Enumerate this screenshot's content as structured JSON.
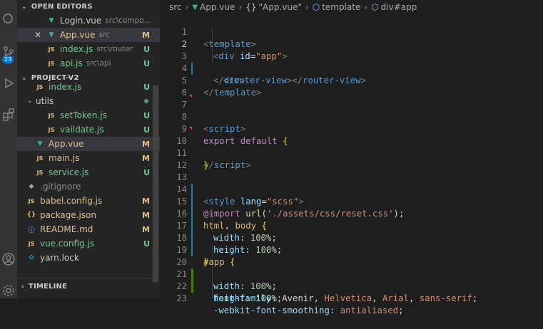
{
  "activity_bar": {
    "badge": "23"
  },
  "open_editors": {
    "title": "OPEN EDITORS",
    "items": [
      {
        "name": "Login.vue",
        "desc": "src\\compo...",
        "status": ""
      },
      {
        "name": "App.vue",
        "desc": "src",
        "status": "M"
      },
      {
        "name": "index.js",
        "desc": "src\\router",
        "status": "U"
      },
      {
        "name": "api.js",
        "desc": "src\\api",
        "status": "U"
      }
    ]
  },
  "project": {
    "title": "PROJECT-V2",
    "items": [
      {
        "name": "index.js",
        "status": "U"
      },
      {
        "name": "utils",
        "status": ""
      },
      {
        "name": "setToken.js",
        "status": "U"
      },
      {
        "name": "vaildate.js",
        "status": "U"
      },
      {
        "name": "App.vue",
        "status": "M"
      },
      {
        "name": "main.js",
        "status": "M"
      },
      {
        "name": "service.js",
        "status": "U"
      },
      {
        "name": ".gitignore",
        "status": ""
      },
      {
        "name": "babel.config.js",
        "status": "M"
      },
      {
        "name": "package.json",
        "status": "M"
      },
      {
        "name": "README.md",
        "status": "M"
      },
      {
        "name": "vue.config.js",
        "status": "U"
      },
      {
        "name": "yarn.lock",
        "status": ""
      }
    ]
  },
  "timeline": {
    "title": "TIMELINE"
  },
  "breadcrumbs": {
    "src": "src",
    "file": "App.vue",
    "obj": "\"App.vue\"",
    "template": "template",
    "div": "div#app"
  },
  "code": {
    "l1": {
      "n": "1",
      "a": "<",
      "b": "template",
      "c": ">"
    },
    "l2": {
      "n": "2",
      "a": "<",
      "b": "div",
      "c": "id",
      "d": "=",
      "e": "\"app\"",
      "f": ">"
    },
    "l3": {
      "n": "3",
      "a": "<",
      "b": "router-view",
      "c": "></",
      "d": "router-view",
      "e": ">"
    },
    "l4": {
      "n": "4",
      "a": "</",
      "b": "div",
      "c": ">"
    },
    "l5": {
      "n": "5",
      "a": "</",
      "b": "template",
      "c": ">"
    },
    "l6": {
      "n": "6"
    },
    "l7": {
      "n": "7",
      "a": "<",
      "b": "script",
      "c": ">"
    },
    "l8": {
      "n": "8"
    },
    "l9": {
      "n": "9",
      "a": "export",
      "b": "default",
      "c": "{"
    },
    "l10": {
      "n": "10",
      "a": "}"
    },
    "l11": {
      "n": "11",
      "a": "</",
      "b": "script",
      "c": ">"
    },
    "l12": {
      "n": "12"
    },
    "l13": {
      "n": "13",
      "a": "<",
      "b": "style",
      "c": "lang",
      "d": "=",
      "e": "\"scss\"",
      "f": ">"
    },
    "l14": {
      "n": "14",
      "a": "@import",
      "b": "url",
      "c": "(",
      "d": "'./assets/css/reset.css'",
      "e": ");"
    },
    "l15": {
      "n": "15",
      "a": "html",
      "b": ", ",
      "c": "body",
      "d": " {"
    },
    "l16": {
      "n": "16",
      "a": "width",
      "b": ": ",
      "c": "100%",
      "d": ";"
    },
    "l17": {
      "n": "17",
      "a": "height",
      "b": ": ",
      "c": "100%",
      "d": ";"
    },
    "l18": {
      "n": "18",
      "a": "}"
    },
    "l19": {
      "n": "19",
      "a": "#app",
      "b": " {"
    },
    "l20": {
      "n": "20",
      "a": "width",
      "b": ": ",
      "c": "100%",
      "d": ";"
    },
    "l21": {
      "n": "21",
      "a": "height",
      "b": ": ",
      "c": "100%",
      "d": ";"
    },
    "l22": {
      "n": "22",
      "a": "font-family",
      "b": ": Avenir, ",
      "c": "Helvetica",
      "d": ", ",
      "e": "Arial",
      "f": ", ",
      "g": "sans-serif",
      "h": ";"
    },
    "l23": {
      "n": "23",
      "a": "-webkit-font-smoothing",
      "b": ": ",
      "c": "antialiased",
      "d": ";"
    }
  }
}
